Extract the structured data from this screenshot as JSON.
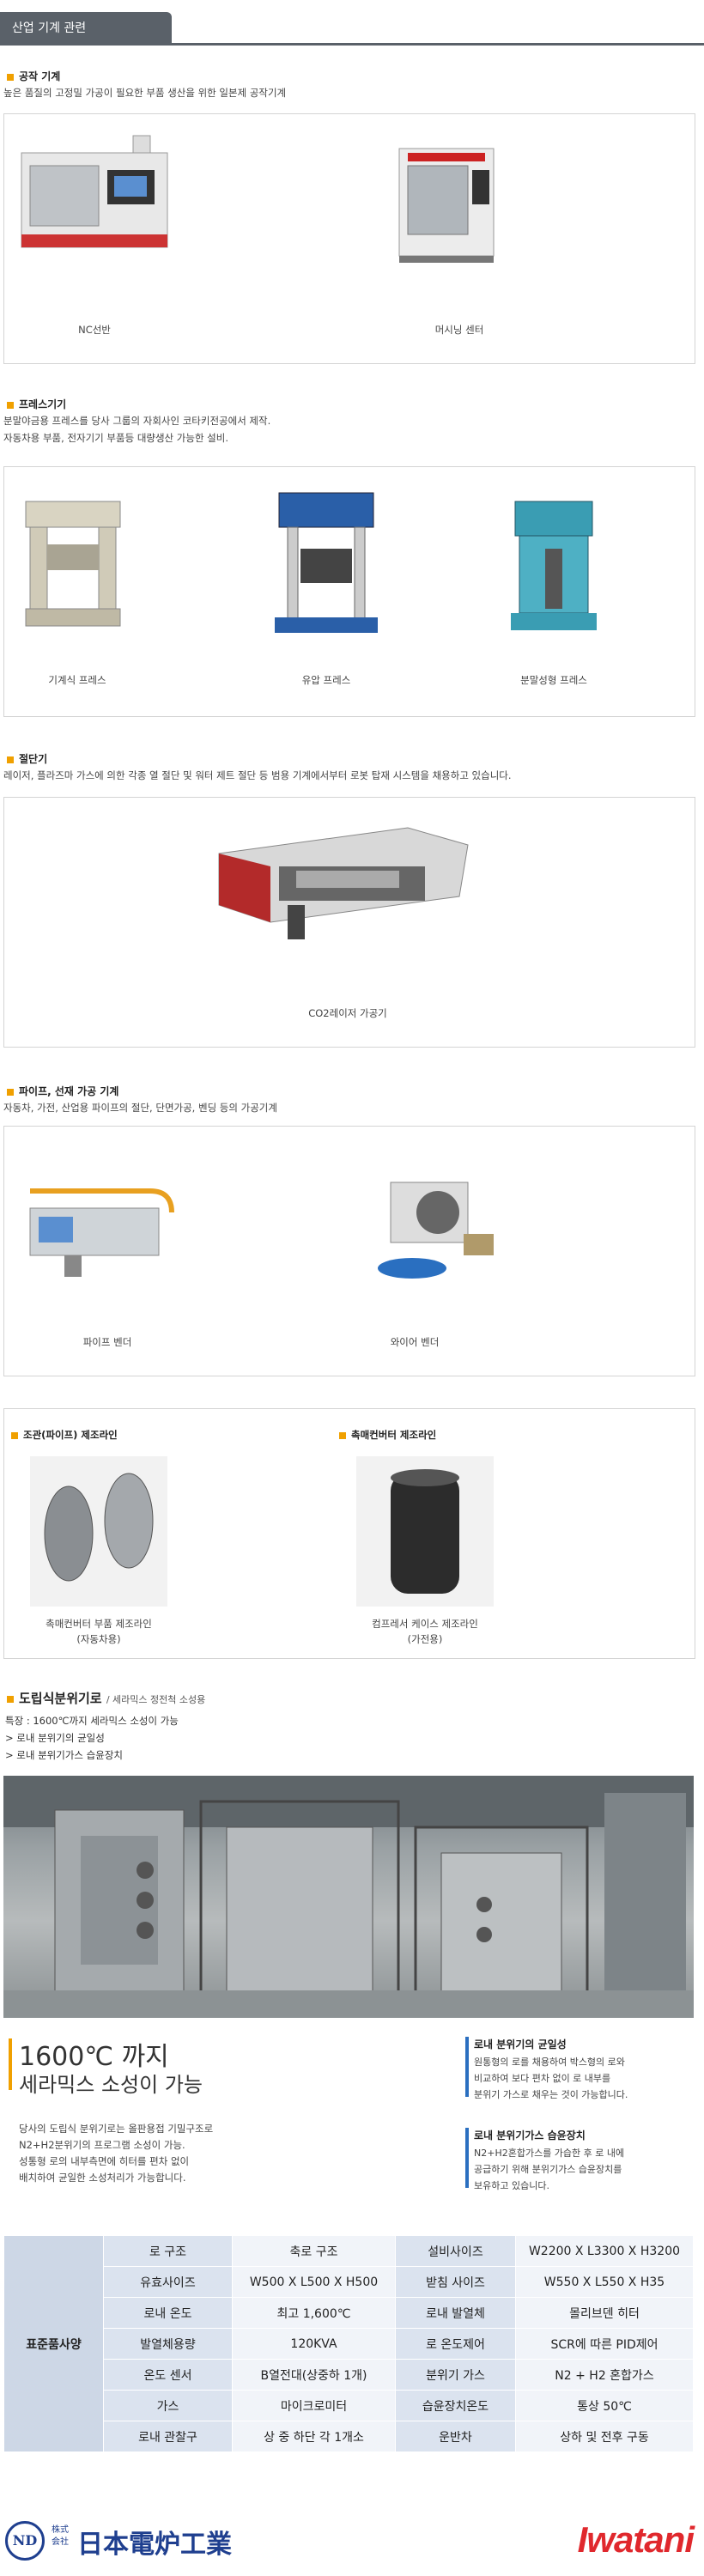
{
  "header": {
    "tab_label": "산업 기계 관련"
  },
  "machine_tools": {
    "title": "공작 기계",
    "desc": "높은 품질의 고정밀 가공이 필요한 부품 생산을 위한 일본제 공작기계",
    "items": [
      {
        "label": "NC선반"
      },
      {
        "label": "머시닝 센터"
      }
    ]
  },
  "press": {
    "title": "프레스기기",
    "desc": [
      "분말야금용 프레스를 당사 그룹의 자회사인 코타키전공에서 제작.",
      "자동차용 부품, 전자기기 부품등 대량생산 가능한 설비."
    ],
    "items": [
      {
        "label": "기계식 프레스"
      },
      {
        "label": "유압 프레스"
      },
      {
        "label": "분말성형 프레스"
      }
    ]
  },
  "cutter": {
    "title": "절단기",
    "desc": "레이저, 플라즈마 가스에 의한 각종 열 절단 및 워터 제트 절단 등 범용 기계에서부터 로봇 탑재 시스템을 채용하고 있습니다.",
    "items": [
      {
        "label": "CO2레이저 가공기"
      }
    ]
  },
  "pipe": {
    "title": "파이프, 선재 가공 기계",
    "desc": "자동차, 가전, 산업용 파이프의 절단, 단면가공, 벤딩 등의 가공기계",
    "items": [
      {
        "label": "파이프 벤더"
      },
      {
        "label": "와이어 벤더"
      }
    ]
  },
  "lines": {
    "left": {
      "title": "조관(파이프) 제조라인",
      "caption1": "촉매컨버터 부품 제조라인",
      "caption2": "(자동차용)"
    },
    "right": {
      "title": "촉매컨버터 제조라인",
      "caption1": "컴프레서 케이스 제조라인",
      "caption2": "(가전용)"
    }
  },
  "furnace": {
    "title": "도립식분위기로",
    "subtitle": "/ 세라믹스 정전척 소성용",
    "features": [
      "특장 : 1600℃까지 세라믹스 소성이 가능",
      "> 로내 분위기의 균일성",
      "> 로내 분위기가스 습윤장치"
    ],
    "headline1": "1600℃ 까지",
    "headline2": "세라믹스 소성이 가능",
    "desc": [
      "당사의 도립식 분위기로는 올판용접 기밀구조로",
      "N2+H2분위기의 프로그램 소성이 가능.",
      "성통형 로의 내부측면에 히터를 편차 없이",
      "배치하여 균일한 소성처리가 가능합니다."
    ],
    "right1": {
      "head": "로내 분위기의 균일성",
      "body": [
        "원통형의 로를 채용하여 박스형의 로와",
        "비교하여 보다 편차 없이 로 내부를",
        "분위기 가스로 채우는 것이 가능합니다."
      ]
    },
    "right2": {
      "head": "로내 분위기가스 습윤장치",
      "body": [
        "N2+H2혼합가스를 가습한 후 로 내에",
        "공급하기 위해 분위기가스 습윤장치를",
        "보유하고 있습니다."
      ]
    }
  },
  "spec_table": {
    "header": "표준품사양",
    "rows": [
      [
        "로 구조",
        "축로 구조",
        "설비사이즈",
        "W2200 X L3300 X H3200"
      ],
      [
        "유효사이즈",
        "W500 X L500 X H500",
        "받침 사이즈",
        "W550 X L550 X H35"
      ],
      [
        "로내 온도",
        "최고 1,600℃",
        "로내 발열체",
        "몰리브덴 히터"
      ],
      [
        "발열체용량",
        "120KVA",
        "로 온도제어",
        "SCR에 따른 PID제어"
      ],
      [
        "온도 센서",
        "B열전대(상중하 1개)",
        "분위기 가스",
        "N2 + H2 혼합가스"
      ],
      [
        "가스",
        "마이크로미터",
        "습윤장치온도",
        "통상 50℃"
      ],
      [
        "로내 관찰구",
        "상 중 하단 각 1개소",
        "운반차",
        "상하 및 전후 구동"
      ]
    ]
  },
  "footer": {
    "left_logo_mark": "ND",
    "left_logo_small1": "株式",
    "left_logo_small2": "会社",
    "left_logo_text": "日本電炉工業",
    "right_logo_text": "Iwatani"
  },
  "colors": {
    "accent": "#f0a000",
    "tab_bg": "#5a6169",
    "table_header": "#cdd7e6",
    "brand_red": "#e0282d",
    "brand_navy": "#1f3f8f"
  }
}
